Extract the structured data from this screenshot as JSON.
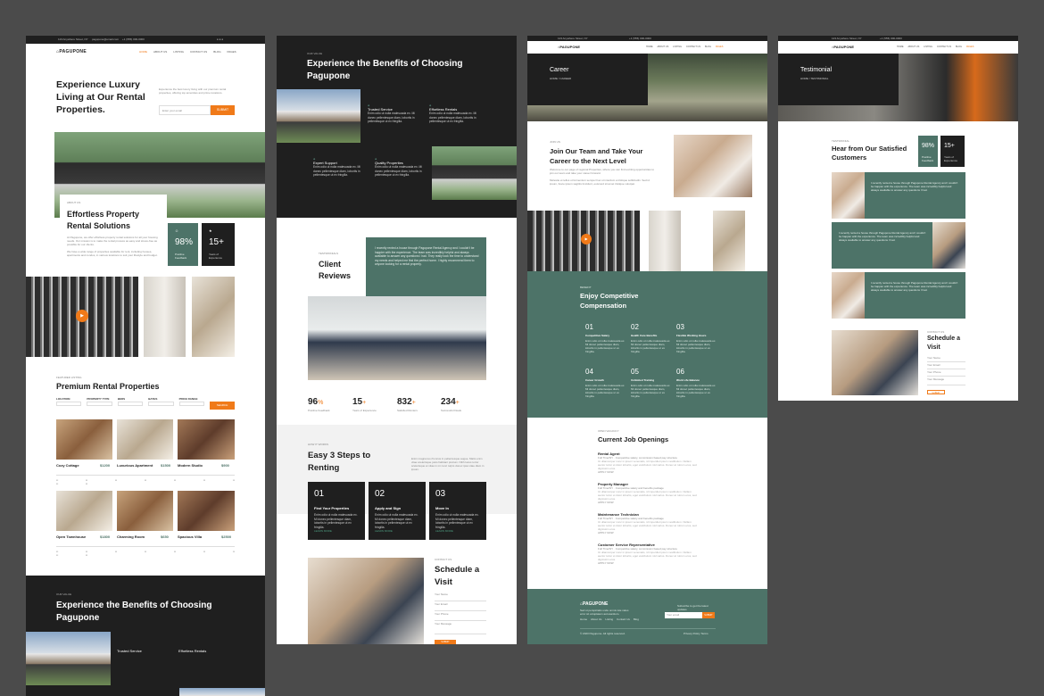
{
  "brand": {
    "logo_text": "PAGUPONE",
    "accent": "#f07a19",
    "teal": "#4d7368",
    "dark": "#1f1f1f",
    "canvas_bg": "#4b4b4b"
  },
  "topbar": {
    "address": "123 Anywhere Street, NY",
    "email": "pagupone@email.com",
    "phone": "+1 (555) 000-0000"
  },
  "nav": {
    "items": [
      "HOME",
      "ABOUT US",
      "LISTING",
      "CONTACT US",
      "BLOG",
      "PAGES"
    ]
  },
  "col1": {
    "hero_title": "Experience Luxury Living at Our Rental Properties.",
    "hero_text": "Experience the best luxury living with our premium rental properties, offering top amenities and prime locations.",
    "email_placeholder": "Enter your email",
    "cta": "SUBMIT",
    "about_eyebrow": "ABOUT US",
    "about_title": "Effortless Property Rental Solutions",
    "about_text": "At Pagupone, we offer effortless property rental solutions for all your housing needs. Our mission is to make the rental process as easy and stress-free as possible for our clients.",
    "about_text2": "We have a wide range of properties available for rent, including houses, apartments and condos, in various locations to suit your lifestyle and budget.",
    "stat1_value": "98%",
    "stat1_label": "Positive Feedback",
    "stat2_value": "15+",
    "stat2_label": "Years of Experience",
    "listing_eyebrow": "FEATURED LISTING",
    "listing_title": "Premium Rental Properties",
    "filters": [
      "LOCATION",
      "PROPERTY TYPE",
      "BEDS",
      "BATHS",
      "PRICE RANGE"
    ],
    "search_btn": "SEARCH",
    "properties": [
      {
        "name": "Cozy Cottage",
        "price": "$1200"
      },
      {
        "name": "Luxurious Apartment",
        "price": "$1500"
      },
      {
        "name": "Modern Studio",
        "price": "$900"
      },
      {
        "name": "Open Townhouse",
        "price": "$1800"
      },
      {
        "name": "Charming Room",
        "price": "$650"
      },
      {
        "name": "Spacious Villa",
        "price": "$2500"
      }
    ],
    "benefits_eyebrow": "OUR VALUE",
    "benefits_title": "Experience the Benefits of Choosing Pagupone",
    "benefit1": "Trusted Service",
    "benefit2": "Effortless Rentals"
  },
  "col2": {
    "benefits_eyebrow": "OUR VALUE",
    "benefits_title": "Experience the Benefits of Choosing Pagupone",
    "benefits": [
      "Trusted Service",
      "Effortless Rentals",
      "Expert Support",
      "Quality Properties"
    ],
    "benefit_text": "Enim odio ut nulla malesuada ex. Mi donec pellentesque diam, lobortis in pellentesque ut ex fringilla.",
    "testimonial_eyebrow": "TESTIMONIALS",
    "testimonial_title": "Client Reviews",
    "testimonial_text": "I recently rented a house through Pagupone Rental Agency and I couldn't be happier with the experience. The team was incredibly helpful and always available to answer any questions I had. They really took the time to understand my needs and helped me find the perfect home. I highly recommend them to anyone looking for a rental property.",
    "counters": [
      {
        "value": "96",
        "suffix": "%",
        "label": "Positive Feedback"
      },
      {
        "value": "15",
        "suffix": "+",
        "label": "Years of Experience"
      },
      {
        "value": "832",
        "suffix": "+",
        "label": "Satisfied Renters"
      },
      {
        "value": "234",
        "suffix": "+",
        "label": "Successful Deals"
      }
    ],
    "steps_eyebrow": "HOW IT WORKS",
    "steps_title": "Easy 3 Steps to Renting",
    "steps_text": "Enim magna leo rhoncus in pellentesque augue. Matis enim vitae scelerisque justo habitant pretium. Nibh lacus tortor scelerisque et vitae in mi nunc turpis donec ipsa vitae diam in ipsum.",
    "steps": [
      {
        "num": "01",
        "title": "Find Your Properties"
      },
      {
        "num": "02",
        "title": "Apply and Sign"
      },
      {
        "num": "03",
        "title": "Move In"
      }
    ],
    "step_text": "Enim odio ut nulla malesuada ex. Mi donec pellentesque diam, lobortis in pellentesque ut ex fringilla.",
    "learn_more": "LEARN MORE",
    "visit_eyebrow": "CONTACT US",
    "visit_title": "Schedule a Visit",
    "visit_fields": [
      "Your Name",
      "Your Email",
      "Your Phone",
      "Your Message"
    ],
    "visit_btn": "SUBMIT"
  },
  "col3": {
    "page_title": "Career",
    "crumb": "HOME / CAREER",
    "join_eyebrow": "JOIN US",
    "join_title": "Join Our Team and Take Your Career to the Next Level",
    "join_text": "Welcome to our page of regional Properties, where you can find exciting opportunities to join our team and take your career forward.",
    "join_text2": "Molestie et tellus ut fermentum semper hac ut interdum a tristique sollicitudin. Sed id ipsum, fusce ipsum sagittis tincidunt, euismod sit amet tristique volutpat.",
    "comp_eyebrow": "BENEFIT",
    "comp_title": "Enjoy Competitive Compensation",
    "comp_items": [
      {
        "num": "01",
        "title": "Competitive Salary"
      },
      {
        "num": "02",
        "title": "Health Care Benefits"
      },
      {
        "num": "03",
        "title": "Flexible Working Hours"
      },
      {
        "num": "04",
        "title": "Career Growth"
      },
      {
        "num": "05",
        "title": "Unlimited Training"
      },
      {
        "num": "06",
        "title": "Work Life Balance"
      }
    ],
    "comp_text": "Enim odio ut nulla malesuada ex. Mi donec pellentesque diam, lobortis in pellentesque ut ex fringilla.",
    "jobs_eyebrow": "OPEN VACANCY",
    "jobs_title": "Current Job Openings",
    "jobs": [
      {
        "title": "Rental Agent",
        "meta": "Competitive salary, commission based pay structure"
      },
      {
        "title": "Property Manager",
        "meta": "Competitive salary and benefits package"
      },
      {
        "title": "Maintenance Technician",
        "meta": "Competitive salary and benefits package"
      },
      {
        "title": "Customer Service Representative",
        "meta": "Competitive salary, commission based pay structure"
      }
    ],
    "job_text": "Ut ullamcorper nunc in ipsum venenatis, id imperdiet ipsum vestibulum. Nullam auctor tortor et dolor lobortis, eget vestibulum nisl varius. Donec at rutrum eros, sed dignissim eros.",
    "job_tag": "Full Time/NY",
    "apply": "APPLY NOW",
    "footer_text": "Sed ut perspiciatis unde omnis iste natus error sit voluptatem accusantium.",
    "footer_links": [
      "Home",
      "About Us",
      "Listing",
      "Contact Us",
      "Blog"
    ],
    "newsletter": "Subscribe to get the latest updates",
    "newsletter_placeholder": "Your email",
    "newsletter_btn": "SUBMIT",
    "copyright": "© 2023 Pagupone. All rights reserved.",
    "privacy": "Privacy Policy  Terms"
  },
  "col4": {
    "page_title": "Testimonial",
    "crumb": "HOME / TESTIMONIAL",
    "eyebrow": "TESTIMONIAL",
    "title": "Hear from Our Satisfied Customers",
    "stat1_value": "98%",
    "stat1_label": "Positive Feedback",
    "stat2_value": "15+",
    "stat2_label": "Years of Experience",
    "review_text": "I recently rented a house through Pagupone Rental Agency and I couldn't be happier with the experience. The team was incredibly helpful and always available to answer any questions I had.",
    "visit_eyebrow": "CONTACT US",
    "visit_title": "Schedule a Visit",
    "visit_fields": [
      "Your Name",
      "Your Email",
      "Your Phone",
      "Your Message"
    ],
    "visit_btn": "SUBMIT"
  }
}
